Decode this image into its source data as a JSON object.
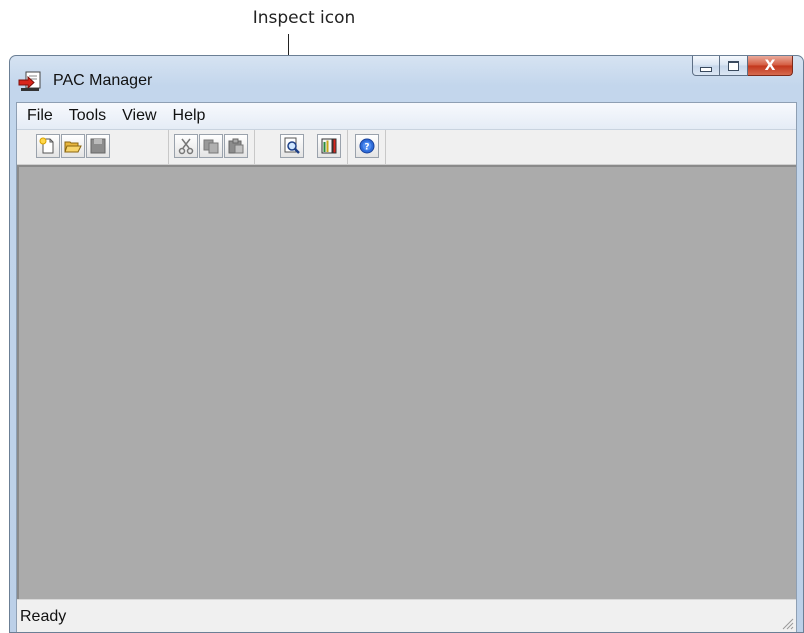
{
  "annotation": {
    "label": "Inspect icon"
  },
  "window": {
    "title": "PAC Manager",
    "controls": {
      "close_glyph": "X"
    }
  },
  "menu": [
    {
      "label": "File"
    },
    {
      "label": "Tools"
    },
    {
      "label": "View"
    },
    {
      "label": "Help"
    }
  ],
  "toolbar": {
    "buttons": [
      {
        "icon": "new-file-icon"
      },
      {
        "icon": "open-folder-icon"
      },
      {
        "icon": "save-icon"
      },
      {
        "icon": "cut-icon"
      },
      {
        "icon": "copy-icon"
      },
      {
        "icon": "paste-icon"
      },
      {
        "icon": "inspect-icon"
      },
      {
        "icon": "tools-bars-icon"
      },
      {
        "icon": "help-icon"
      }
    ]
  },
  "status": {
    "text": "Ready"
  },
  "colors": {
    "workspace": "#ababab",
    "title_gradient": "#c3d6ec",
    "close_button": "#c2361c"
  }
}
